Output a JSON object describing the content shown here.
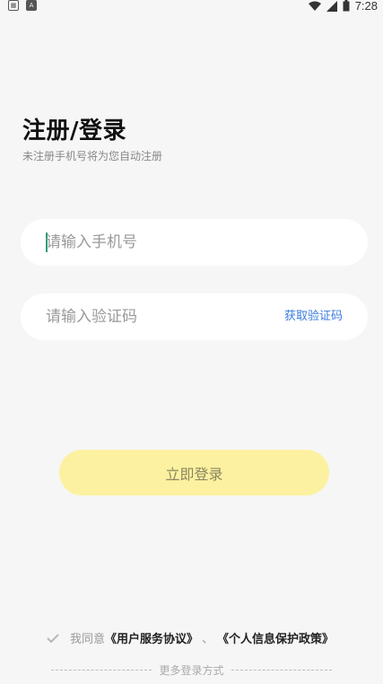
{
  "status_bar": {
    "left_icons": [
      "sim-icon",
      "notification-a-icon"
    ],
    "time": "7:28",
    "right_icons": [
      "wifi-icon",
      "signal-icon",
      "battery-icon"
    ]
  },
  "header": {
    "title": "注册/登录",
    "subtitle": "未注册手机号将为您自动注册"
  },
  "form": {
    "phone_placeholder": "请输入手机号",
    "code_placeholder": "请输入验证码",
    "get_code_label": "获取验证码"
  },
  "login_button_label": "立即登录",
  "agreement": {
    "prefix": "我同意",
    "user_agreement": "《用户服务协议》",
    "separator": "、",
    "privacy_policy": "《个人信息保护政策》",
    "checked": true
  },
  "more_login_label": "更多登录方式",
  "colors": {
    "background": "#f6f6f6",
    "button": "#fcf1a0",
    "link": "#3a7be0",
    "caret": "#2f9e7a"
  }
}
